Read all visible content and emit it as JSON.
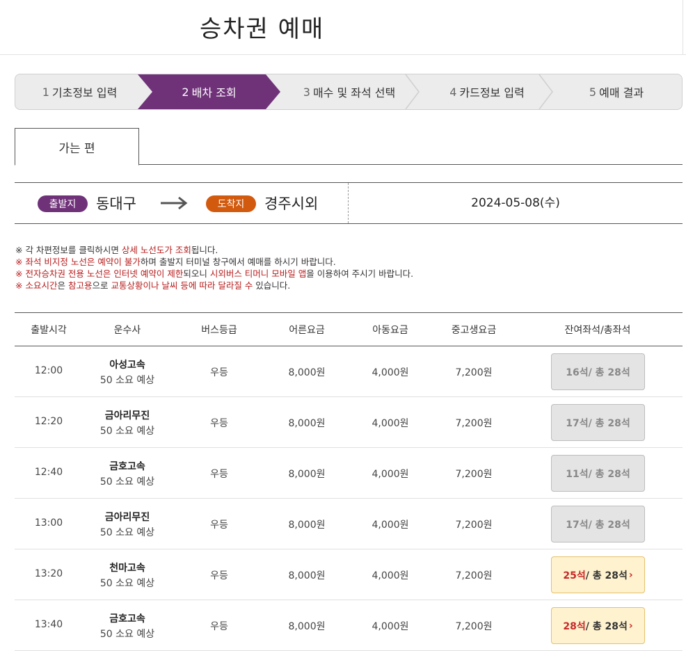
{
  "page": {
    "title": "승차권 예매"
  },
  "steps": [
    {
      "num": "1",
      "label": "기초정보 입력",
      "active": false
    },
    {
      "num": "2",
      "label": "배차 조회",
      "active": true
    },
    {
      "num": "3",
      "label": "매수 및 좌석 선택",
      "active": false
    },
    {
      "num": "4",
      "label": "카드정보 입력",
      "active": false
    },
    {
      "num": "5",
      "label": "예매 결과",
      "active": false
    }
  ],
  "tabs": {
    "outbound": "가는 편"
  },
  "route": {
    "dep_badge": "출발지",
    "dep_city": "동대구",
    "arr_badge": "도착지",
    "arr_city": "경주시외",
    "date": "2024-05-08(수)"
  },
  "notices": {
    "n1_mark": "※",
    "n1_a": " 각 차편정보를 클릭하시면 ",
    "n1_hl": "상세 노선도가 조회",
    "n1_b": "됩니다.",
    "n2_mark": "※",
    "n2_hl": " 좌석 비지정 노선은 예약이 불가",
    "n2_b": "하며 출발지 터미널 창구에서 예매를 하시기 바랍니다.",
    "n3_mark": "※",
    "n3_hl1": " 전자승차권 전용 노선은 인터넷 예약이 제한",
    "n3_a": "되오니 ",
    "n3_hl2": "시외버스 티머니 모바일 앱",
    "n3_b": "을 이용하여 주시기 바랍니다.",
    "n4_mark": "※",
    "n4_hl1": " 소요시간",
    "n4_a": "은 ",
    "n4_hl2": "참고용",
    "n4_b": "으로 ",
    "n4_hl3": "교통상황이나 날씨 등에 따라 달라질 수",
    "n4_c": " 있습니다."
  },
  "table": {
    "headers": {
      "time": "출발시각",
      "company": "운수사",
      "grade": "버스등급",
      "adult": "어른요금",
      "child": "아동요금",
      "student": "중고생요금",
      "seats": "잔여좌석/총좌석"
    },
    "rows": [
      {
        "time": "12:00",
        "company": "아성고속",
        "duration": "50 소요 예상",
        "grade": "우등",
        "adult": "8,000원",
        "child": "4,000원",
        "student": "7,200원",
        "remain": "16석",
        "total": " / 총 28석",
        "available": false
      },
      {
        "time": "12:20",
        "company": "금아리무진",
        "duration": "50 소요 예상",
        "grade": "우등",
        "adult": "8,000원",
        "child": "4,000원",
        "student": "7,200원",
        "remain": "17석",
        "total": " / 총 28석",
        "available": false
      },
      {
        "time": "12:40",
        "company": "금호고속",
        "duration": "50 소요 예상",
        "grade": "우등",
        "adult": "8,000원",
        "child": "4,000원",
        "student": "7,200원",
        "remain": "11석",
        "total": " / 총 28석",
        "available": false
      },
      {
        "time": "13:00",
        "company": "금아리무진",
        "duration": "50 소요 예상",
        "grade": "우등",
        "adult": "8,000원",
        "child": "4,000원",
        "student": "7,200원",
        "remain": "17석",
        "total": " / 총 28석",
        "available": false
      },
      {
        "time": "13:20",
        "company": "천마고속",
        "duration": "50 소요 예상",
        "grade": "우등",
        "adult": "8,000원",
        "child": "4,000원",
        "student": "7,200원",
        "remain": "25석",
        "total": " / 총 28석",
        "available": true
      },
      {
        "time": "13:40",
        "company": "금호고속",
        "duration": "50 소요 예상",
        "grade": "우등",
        "adult": "8,000원",
        "child": "4,000원",
        "student": "7,200원",
        "remain": "28석",
        "total": " / 총 28석",
        "available": true
      }
    ]
  },
  "colors": {
    "accent": "#6f3279",
    "arrival": "#d25a0e",
    "highlight": "#b71c1c",
    "available_bg": "#fff2cf"
  },
  "icons": {
    "arrow": "right-arrow-icon",
    "chevron": "chevron-right-icon"
  }
}
